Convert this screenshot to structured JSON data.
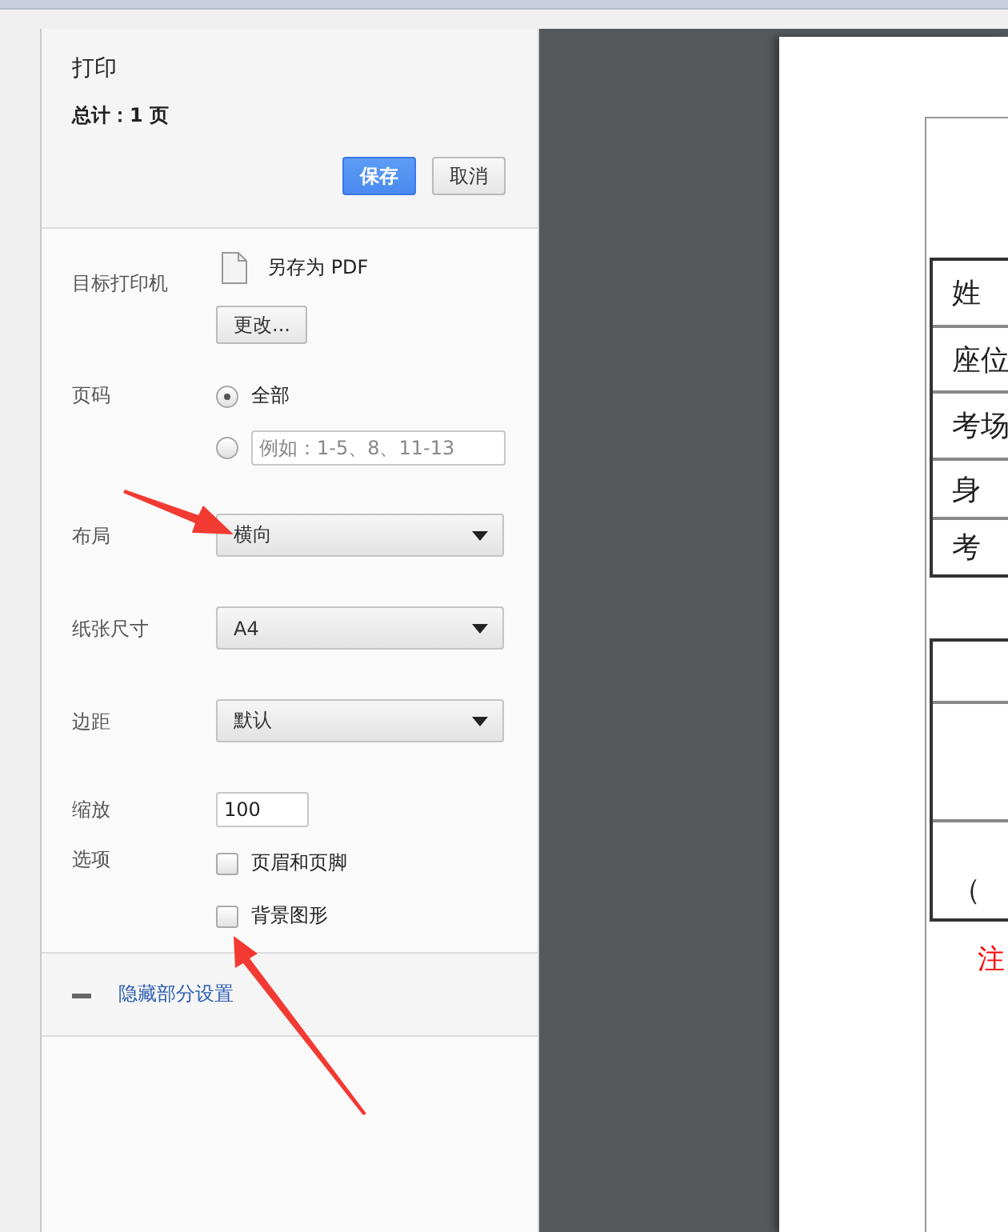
{
  "dialog": {
    "title": "打印",
    "total": "总计：1 页",
    "buttons": [
      {
        "label": "保存",
        "kind": "primary"
      },
      {
        "label": "取消",
        "kind": "secondary"
      }
    ]
  },
  "destination": {
    "label": "目标打印机",
    "name": "另存为 PDF",
    "change_button": "更改..."
  },
  "pages": {
    "label": "页码",
    "options": [
      {
        "kind": "all",
        "label": "全部",
        "selected": true
      },
      {
        "kind": "custom",
        "placeholder": "例如：1-5、8、11-13",
        "selected": false
      }
    ]
  },
  "settings": [
    {
      "kind": "select",
      "label": "布局",
      "value": "横向"
    },
    {
      "kind": "select",
      "label": "纸张尺寸",
      "value": "A4"
    },
    {
      "kind": "select",
      "label": "边距",
      "value": "默认"
    },
    {
      "kind": "input",
      "label": "缩放",
      "value": "100"
    }
  ],
  "options": {
    "label": "选项",
    "items": [
      {
        "label": "页眉和页脚",
        "checked": false
      },
      {
        "label": "背景图形",
        "checked": false
      }
    ]
  },
  "more_settings": {
    "label": "隐藏部分设置",
    "expanded": true
  },
  "preview": {
    "table_1": [
      "姓",
      "座位",
      "考场",
      "身",
      "考"
    ],
    "table_2": [
      "（"
    ],
    "note": "注"
  }
}
